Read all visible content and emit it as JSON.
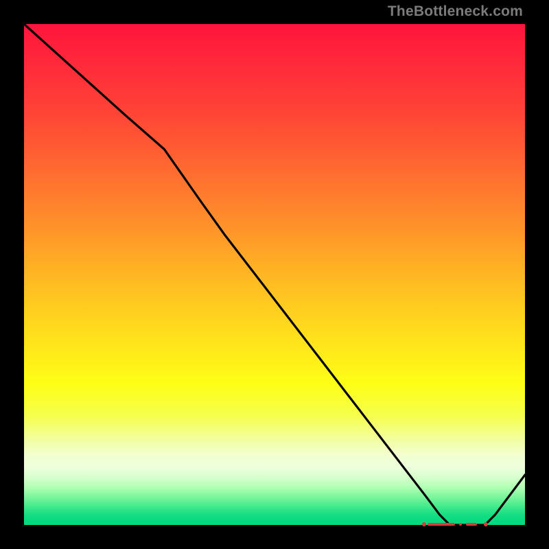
{
  "attribution": "TheBottleneck.com",
  "colors": {
    "frame": "#000000",
    "curve": "#000000",
    "marker": "#d93a3a",
    "attribution_text": "#7b7b7b"
  },
  "chart_data": {
    "type": "line",
    "title": "",
    "xlabel": "",
    "ylabel": "",
    "xlim": [
      0,
      100
    ],
    "ylim": [
      0,
      100
    ],
    "grid": false,
    "legend": false,
    "series": [
      {
        "name": "curve",
        "x": [
          0,
          10,
          20,
          28,
          35,
          40,
          50,
          60,
          70,
          80,
          83,
          85,
          88,
          90,
          92,
          94,
          100
        ],
        "values": [
          100,
          91,
          82,
          75,
          65,
          58,
          45,
          32,
          19,
          6,
          2,
          0,
          0,
          0,
          0,
          2,
          10
        ]
      }
    ],
    "flat_region_x": [
      80,
      92
    ],
    "flat_region_y": 0,
    "background_gradient": "vertical red→yellow→green"
  }
}
